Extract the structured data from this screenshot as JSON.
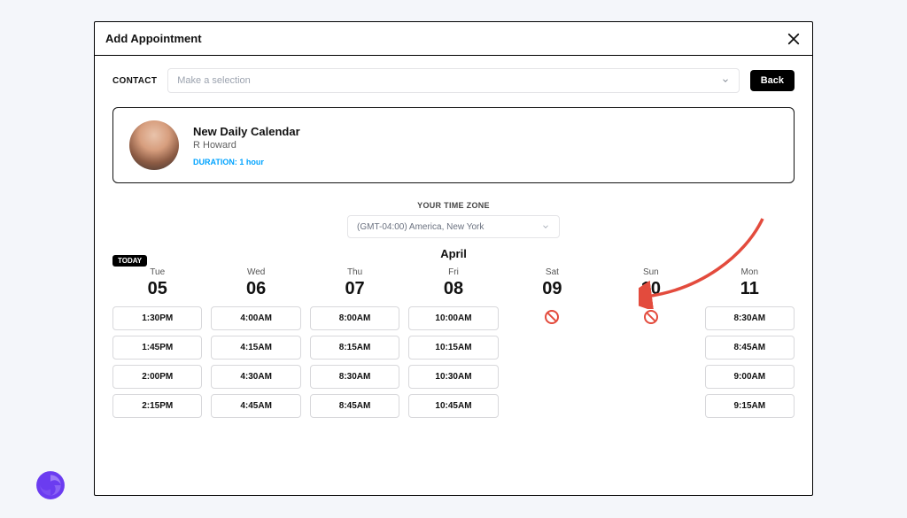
{
  "modal": {
    "title": "Add Appointment"
  },
  "contact": {
    "label": "CONTACT",
    "placeholder": "Make a selection",
    "back_label": "Back"
  },
  "card": {
    "title": "New Daily Calendar",
    "subtitle": "R Howard",
    "duration": "DURATION: 1 hour"
  },
  "timezone": {
    "label": "YOUR TIME ZONE",
    "value": "(GMT-04:00) America, New York"
  },
  "month": "April",
  "today_label": "TODAY",
  "days": [
    {
      "name": "Tue",
      "num": "05",
      "today": true,
      "slots": [
        "1:30PM",
        "1:45PM",
        "2:00PM",
        "2:15PM"
      ]
    },
    {
      "name": "Wed",
      "num": "06",
      "today": false,
      "slots": [
        "4:00AM",
        "4:15AM",
        "4:30AM",
        "4:45AM"
      ]
    },
    {
      "name": "Thu",
      "num": "07",
      "today": false,
      "slots": [
        "8:00AM",
        "8:15AM",
        "8:30AM",
        "8:45AM"
      ]
    },
    {
      "name": "Fri",
      "num": "08",
      "today": false,
      "slots": [
        "10:00AM",
        "10:15AM",
        "10:30AM",
        "10:45AM"
      ]
    },
    {
      "name": "Sat",
      "num": "09",
      "today": false,
      "slots": []
    },
    {
      "name": "Sun",
      "num": "10",
      "today": false,
      "slots": []
    },
    {
      "name": "Mon",
      "num": "11",
      "today": false,
      "slots": [
        "8:30AM",
        "8:45AM",
        "9:00AM",
        "9:15AM"
      ]
    }
  ]
}
